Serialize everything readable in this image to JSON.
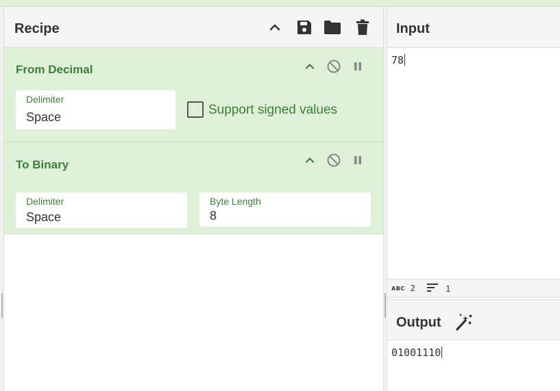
{
  "recipe": {
    "title": "Recipe",
    "icons": [
      "chevron-up-icon",
      "save-icon",
      "folder-icon",
      "trash-icon"
    ],
    "operations": [
      {
        "name": "From Decimal",
        "delimiter_label": "Delimiter",
        "delimiter_value": "Space",
        "checkbox_label": "Support signed values",
        "checkbox_checked": false
      },
      {
        "name": "To Binary",
        "delimiter_label": "Delimiter",
        "delimiter_value": "Space",
        "byte_length_label": "Byte Length",
        "byte_length_value": "8"
      }
    ]
  },
  "input": {
    "title": "Input",
    "text": "78",
    "status": {
      "abc_label": "ABC",
      "length": "2",
      "lines": "1"
    }
  },
  "output": {
    "title": "Output",
    "text": "01001110"
  },
  "colors": {
    "op_background": "#dff0d8",
    "op_text": "#3d7f3a",
    "header_background": "#f5f5f5",
    "text": "#333333"
  }
}
